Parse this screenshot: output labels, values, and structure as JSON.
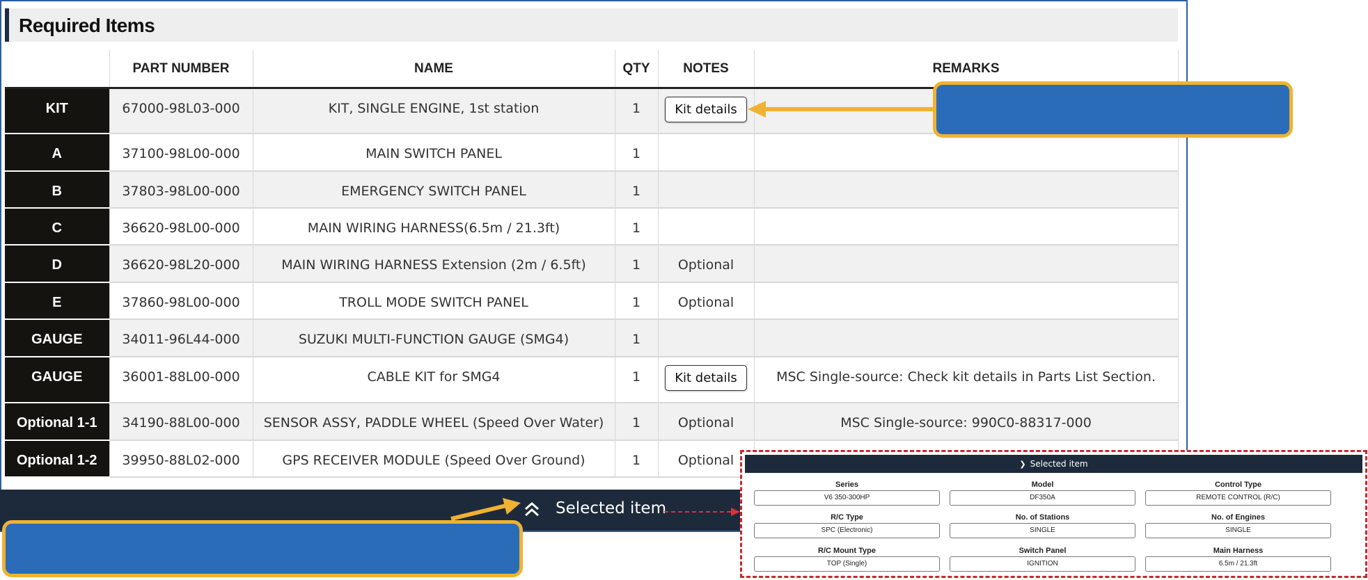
{
  "section": {
    "title": "Required Items"
  },
  "table": {
    "headers": [
      "",
      "PART NUMBER",
      "NAME",
      "QTY",
      "NOTES",
      "REMARKS"
    ],
    "rows": [
      {
        "label": "KIT",
        "part": "67000-98L03-000",
        "name": "KIT, SINGLE ENGINE, 1st station",
        "qty": "1",
        "notes": "",
        "button": "Kit details",
        "remarks": ""
      },
      {
        "label": "A",
        "part": "37100-98L00-000",
        "name": "MAIN SWITCH PANEL",
        "qty": "1",
        "notes": "",
        "button": "",
        "remarks": ""
      },
      {
        "label": "B",
        "part": "37803-98L00-000",
        "name": "EMERGENCY SWITCH PANEL",
        "qty": "1",
        "notes": "",
        "button": "",
        "remarks": ""
      },
      {
        "label": "C",
        "part": "36620-98L00-000",
        "name": "MAIN WIRING HARNESS(6.5m / 21.3ft)",
        "qty": "1",
        "notes": "",
        "button": "",
        "remarks": ""
      },
      {
        "label": "D",
        "part": "36620-98L20-000",
        "name": "MAIN WIRING HARNESS Extension (2m / 6.5ft)",
        "qty": "1",
        "notes": "Optional",
        "button": "",
        "remarks": ""
      },
      {
        "label": "E",
        "part": "37860-98L00-000",
        "name": "TROLL MODE SWITCH PANEL",
        "qty": "1",
        "notes": "Optional",
        "button": "",
        "remarks": ""
      },
      {
        "label": "GAUGE",
        "part": "34011-96L44-000",
        "name": "SUZUKI MULTI-FUNCTION GAUGE (SMG4)",
        "qty": "1",
        "notes": "",
        "button": "",
        "remarks": ""
      },
      {
        "label": "GAUGE",
        "part": "36001-88L00-000",
        "name": "CABLE KIT for SMG4",
        "qty": "1",
        "notes": "",
        "button": "Kit details",
        "remarks": "MSC Single-source: Check kit details in Parts List Section."
      },
      {
        "label": "Optional 1-1",
        "part": "34190-88L00-000",
        "name": "SENSOR ASSY, PADDLE WHEEL (Speed Over Water)",
        "qty": "1",
        "notes": "Optional",
        "button": "",
        "remarks": "MSC Single-source: 990C0-88317-000"
      },
      {
        "label": "Optional 1-2",
        "part": "39950-88L02-000",
        "name": "GPS RECEIVER MODULE (Speed Over Ground)",
        "qty": "1",
        "notes": "Optional",
        "button": "",
        "remarks": ""
      }
    ]
  },
  "footer": {
    "label": "Selected item"
  },
  "selected_panel": {
    "title": "Selected item",
    "fields": [
      {
        "label": "Series",
        "value": "V6 350-300HP"
      },
      {
        "label": "Model",
        "value": "DF350A"
      },
      {
        "label": "Control Type",
        "value": "REMOTE CONTROL (R/C)"
      },
      {
        "label": "R/C Type",
        "value": "SPC (Electronic)"
      },
      {
        "label": "No. of Stations",
        "value": "SINGLE"
      },
      {
        "label": "No. of Engines",
        "value": "SINGLE"
      },
      {
        "label": "R/C Mount Type",
        "value": "TOP (Single)"
      },
      {
        "label": "Switch Panel",
        "value": "IGNITION"
      },
      {
        "label": "Main Harness",
        "value": "6.5m / 21.3ft"
      }
    ]
  },
  "colors": {
    "accent_navy": "#1d2a3c",
    "callout_blue": "#2b6cb8",
    "callout_border": "#f0b232",
    "panel_border": "#c9282e"
  },
  "icons": {
    "footer": "chevrons-up-icon",
    "panel": "chevrons-down-icon"
  }
}
